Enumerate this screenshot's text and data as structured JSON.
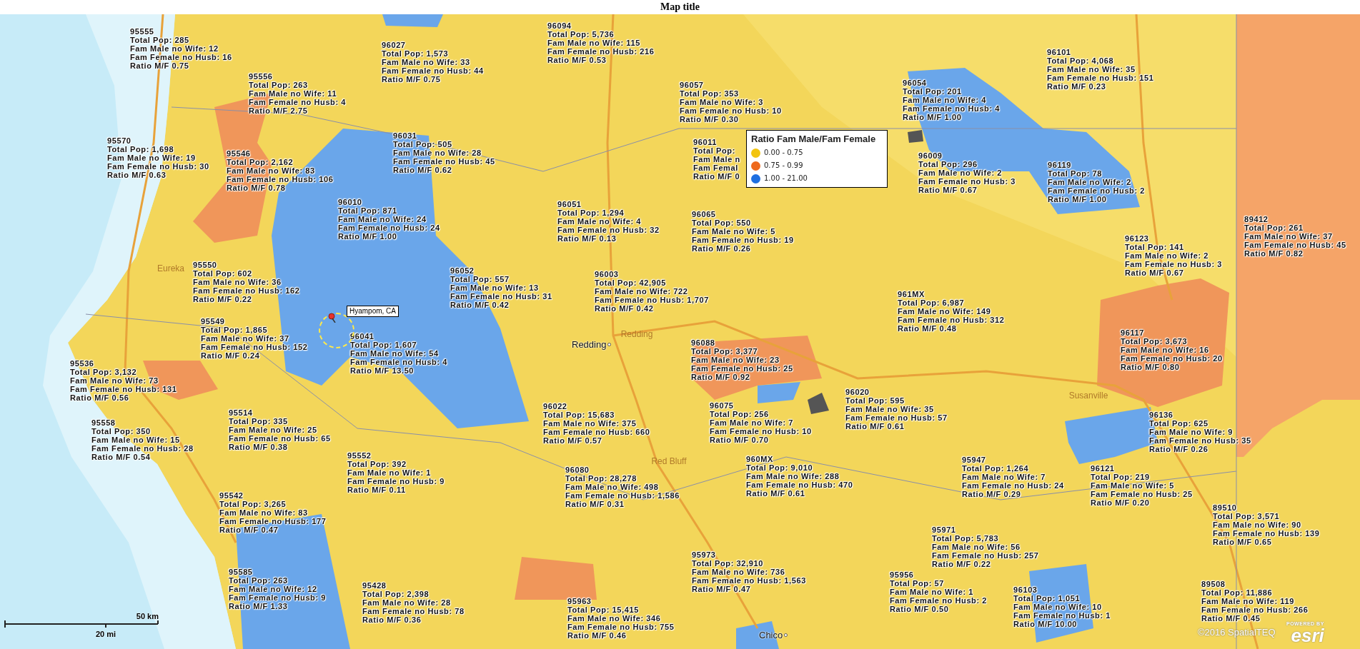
{
  "title": "Map title",
  "legend": {
    "title": "Ratio Fam Male/Fam Female",
    "classes": [
      {
        "label": "0.00 - 0.75",
        "color": "#f2c40f"
      },
      {
        "label": "0.75 - 0.99",
        "color": "#ee6a1e"
      },
      {
        "label": "1.00 - 21.00",
        "color": "#1f6fe0"
      }
    ]
  },
  "zip_labels": [
    {
      "zip": "95555",
      "lines": [
        "Total Pop: 285",
        "Fam Male no Wife: 12",
        "Fam Female no Husb: 16",
        "Ratio M/F 0.75"
      ]
    },
    {
      "zip": "96027",
      "lines": [
        "Total Pop: 1,573",
        "Fam Male no Wife: 33",
        "Fam Female no Husb: 44",
        "Ratio M/F 0.75"
      ]
    },
    {
      "zip": "96094",
      "lines": [
        "Total Pop: 5,736",
        "Fam Male no Wife: 115",
        "Fam Female no Husb: 216",
        "Ratio M/F 0.53"
      ]
    },
    {
      "zip": "95556",
      "lines": [
        "Total Pop: 263",
        "Fam Male no Wife: 11",
        "Fam Female no Husb: 4",
        "Ratio M/F 2.75"
      ]
    },
    {
      "zip": "96057",
      "lines": [
        "Total Pop: 353",
        "Fam Male no Wife: 3",
        "Fam Female no Husb: 10",
        "Ratio M/F 0.30"
      ]
    },
    {
      "zip": "96054",
      "lines": [
        "Total Pop: 201",
        "Fam Male no Wife: 4",
        "Fam Female no Husb: 4",
        "Ratio M/F 1.00"
      ]
    },
    {
      "zip": "96101",
      "lines": [
        "Total Pop: 4,068",
        "Fam Male no Wife: 35",
        "Fam Female no Husb: 151",
        "Ratio M/F 0.23"
      ]
    },
    {
      "zip": "96031",
      "lines": [
        "Total Pop: 505",
        "Fam Male no Wife: 28",
        "Fam Female no Husb: 45",
        "Ratio M/F 0.62"
      ]
    },
    {
      "zip": "95570",
      "lines": [
        "Total Pop: 1,698",
        "Fam Male no Wife: 19",
        "Fam Female no Husb: 30",
        "Ratio M/F 0.63"
      ]
    },
    {
      "zip": "96011",
      "lines": [
        "Total Pop:",
        "Fam Male n",
        "Fam Femal",
        "Ratio M/F 0"
      ]
    },
    {
      "zip": "95546",
      "lines": [
        "Total Pop: 2,162",
        "Fam Male no Wife: 83",
        "Fam Female no Husb: 106",
        "Ratio M/F 0.78"
      ]
    },
    {
      "zip": "96009",
      "lines": [
        "Total Pop: 296",
        "Fam Male no Wife: 2",
        "Fam Female no Husb: 3",
        "Ratio M/F 0.67"
      ]
    },
    {
      "zip": "96119",
      "lines": [
        "Total Pop: 78",
        "Fam Male no Wife: 2",
        "Fam Female no Husb: 2",
        "Ratio M/F 1.00"
      ]
    },
    {
      "zip": "96010",
      "lines": [
        "Total Pop: 871",
        "Fam Male no Wife: 24",
        "Fam Female no Husb: 24",
        "Ratio M/F 1.00"
      ]
    },
    {
      "zip": "96051",
      "lines": [
        "Total Pop: 1,294",
        "Fam Male no Wife: 4",
        "Fam Female no Husb: 32",
        "Ratio M/F 0.13"
      ]
    },
    {
      "zip": "96065",
      "lines": [
        "Total Pop: 550",
        "Fam Male no Wife: 5",
        "Fam Female no Husb: 19",
        "Ratio M/F 0.26"
      ]
    },
    {
      "zip": "89412",
      "lines": [
        "Total Pop: 261",
        "Fam Male no Wife: 37",
        "Fam Female no Husb: 45",
        "Ratio M/F 0.82"
      ]
    },
    {
      "zip": "96123",
      "lines": [
        "Total Pop: 141",
        "Fam Male no Wife: 2",
        "Fam Female no Husb: 3",
        "Ratio M/F 0.67"
      ]
    },
    {
      "zip": "95550",
      "lines": [
        "Total Pop: 602",
        "Fam Male no Wife: 36",
        "Fam Female no Husb: 162",
        "Ratio M/F 0.22"
      ]
    },
    {
      "zip": "96052",
      "lines": [
        "Total Pop: 557",
        "Fam Male no Wife: 13",
        "Fam Female no Husb: 31",
        "Ratio M/F 0.42"
      ]
    },
    {
      "zip": "96003",
      "lines": [
        "Total Pop: 42,905",
        "Fam Male no Wife: 722",
        "Fam Female no Husb: 1,707",
        "Ratio M/F 0.42"
      ]
    },
    {
      "zip": "961MX",
      "lines": [
        "Total Pop: 6,987",
        "Fam Male no Wife: 149",
        "Fam Female no Husb: 312",
        "Ratio M/F 0.48"
      ]
    },
    {
      "zip": "95549",
      "lines": [
        "Total Pop: 1,865",
        "Fam Male no Wife: 37",
        "Fam Female no Husb: 152",
        "Ratio M/F 0.24"
      ]
    },
    {
      "zip": "96041",
      "lines": [
        "Total Pop: 1,607",
        "Fam Male no Wife: 54",
        "Fam Female no Husb: 4",
        "Ratio M/F 13.50"
      ]
    },
    {
      "zip": "96117",
      "lines": [
        "Total Pop: 3,673",
        "Fam Male no Wife: 16",
        "Fam Female no Husb: 20",
        "Ratio M/F 0.80"
      ]
    },
    {
      "zip": "96088",
      "lines": [
        "Total Pop: 3,377",
        "Fam Male no Wife: 23",
        "Fam Female no Husb: 25",
        "Ratio M/F 0.92"
      ]
    },
    {
      "zip": "95536",
      "lines": [
        "Total Pop: 3,132",
        "Fam Male no Wife: 73",
        "Fam Female no Husb: 131",
        "Ratio M/F 0.56"
      ]
    },
    {
      "zip": "96020",
      "lines": [
        "Total Pop: 595",
        "Fam Male no Wife: 35",
        "Fam Female no Husb: 57",
        "Ratio M/F 0.61"
      ]
    },
    {
      "zip": "95514",
      "lines": [
        "Total Pop: 335",
        "Fam Male no Wife: 25",
        "Fam Female no Husb: 65",
        "Ratio M/F 0.38"
      ]
    },
    {
      "zip": "96022",
      "lines": [
        "Total Pop: 15,683",
        "Fam Male no Wife: 375",
        "Fam Female no Husb: 660",
        "Ratio M/F 0.57"
      ]
    },
    {
      "zip": "96075",
      "lines": [
        "Total Pop: 256",
        "Fam Male no Wife: 7",
        "Fam Female no Husb: 10",
        "Ratio M/F 0.70"
      ]
    },
    {
      "zip": "96136",
      "lines": [
        "Total Pop: 625",
        "Fam Male no Wife: 9",
        "Fam Female no Husb: 35",
        "Ratio M/F 0.26"
      ]
    },
    {
      "zip": "95558",
      "lines": [
        "Total Pop: 350",
        "Fam Male no Wife: 15",
        "Fam Female no Husb: 28",
        "Ratio M/F 0.54"
      ]
    },
    {
      "zip": "95552",
      "lines": [
        "Total Pop: 392",
        "Fam Male no Wife: 1",
        "Fam Female no Husb: 9",
        "Ratio M/F 0.11"
      ]
    },
    {
      "zip": "95947",
      "lines": [
        "Total Pop: 1,264",
        "Fam Male no Wife: 7",
        "Fam Female no Husb: 24",
        "Ratio M/F 0.29"
      ]
    },
    {
      "zip": "96080",
      "lines": [
        "Total Pop: 28,278",
        "Fam Male no Wife: 498",
        "Fam Female no Husb: 1,586",
        "Ratio M/F 0.31"
      ]
    },
    {
      "zip": "960MX",
      "lines": [
        "Total Pop: 9,010",
        "Fam Male no Wife: 288",
        "Fam Female no Husb: 470",
        "Ratio M/F 0.61"
      ]
    },
    {
      "zip": "96121",
      "lines": [
        "Total Pop: 219",
        "Fam Male no Wife: 5",
        "Fam Female no Husb: 25",
        "Ratio M/F 0.20"
      ]
    },
    {
      "zip": "95542",
      "lines": [
        "Total Pop: 3,265",
        "Fam Male no Wife: 83",
        "Fam Female no Husb: 177",
        "Ratio M/F 0.47"
      ]
    },
    {
      "zip": "89510",
      "lines": [
        "Total Pop: 3,571",
        "Fam Male no Wife: 90",
        "Fam Female no Husb: 139",
        "Ratio M/F 0.65"
      ]
    },
    {
      "zip": "95971",
      "lines": [
        "Total Pop: 5,783",
        "Fam Male no Wife: 56",
        "Fam Female no Husb: 257",
        "Ratio M/F 0.22"
      ]
    },
    {
      "zip": "95973",
      "lines": [
        "Total Pop: 32,910",
        "Fam Male no Wife: 736",
        "Fam Female no Husb: 1,563",
        "Ratio M/F 0.47"
      ]
    },
    {
      "zip": "95585",
      "lines": [
        "Total Pop: 263",
        "Fam Male no Wife: 12",
        "Fam Female no Husb: 9",
        "Ratio M/F 1.33"
      ]
    },
    {
      "zip": "95956",
      "lines": [
        "Total Pop: 57",
        "Fam Male no Wife: 1",
        "Fam Female no Husb: 2",
        "Ratio M/F 0.50"
      ]
    },
    {
      "zip": "95428",
      "lines": [
        "Total Pop: 2,398",
        "Fam Male no Wife: 28",
        "Fam Female no Husb: 78",
        "Ratio M/F 0.36"
      ]
    },
    {
      "zip": "96103",
      "lines": [
        "Total Pop: 1,051",
        "Fam Male no Wife: 10",
        "Fam Female no Husb: 1",
        "Ratio M/F 10.00"
      ]
    },
    {
      "zip": "89508",
      "lines": [
        "Total Pop: 11,886",
        "Fam Male no Wife: 119",
        "Fam Female no Husb: 266",
        "Ratio M/F 0.45"
      ]
    },
    {
      "zip": "95963",
      "lines": [
        "Total Pop: 15,415",
        "Fam Male no Wife: 346",
        "Fam Female no Husb: 755",
        "Ratio M/F 0.46"
      ]
    }
  ],
  "places": [
    {
      "kind": "town",
      "name": "Eureka"
    },
    {
      "kind": "city",
      "name": "Redding"
    },
    {
      "kind": "town",
      "name": "Redding"
    },
    {
      "kind": "town",
      "name": "Red Bluff"
    },
    {
      "kind": "city",
      "name": "Chico"
    },
    {
      "kind": "town",
      "name": "Susanville"
    }
  ],
  "marker": {
    "label": "Hyampom, CA"
  },
  "scale_bar": {
    "metric": "50 km",
    "imperial": "20 mi"
  },
  "attribution": "©2016 SpatialTEQ",
  "logo": {
    "caption": "POWERED BY",
    "name": "esri"
  }
}
